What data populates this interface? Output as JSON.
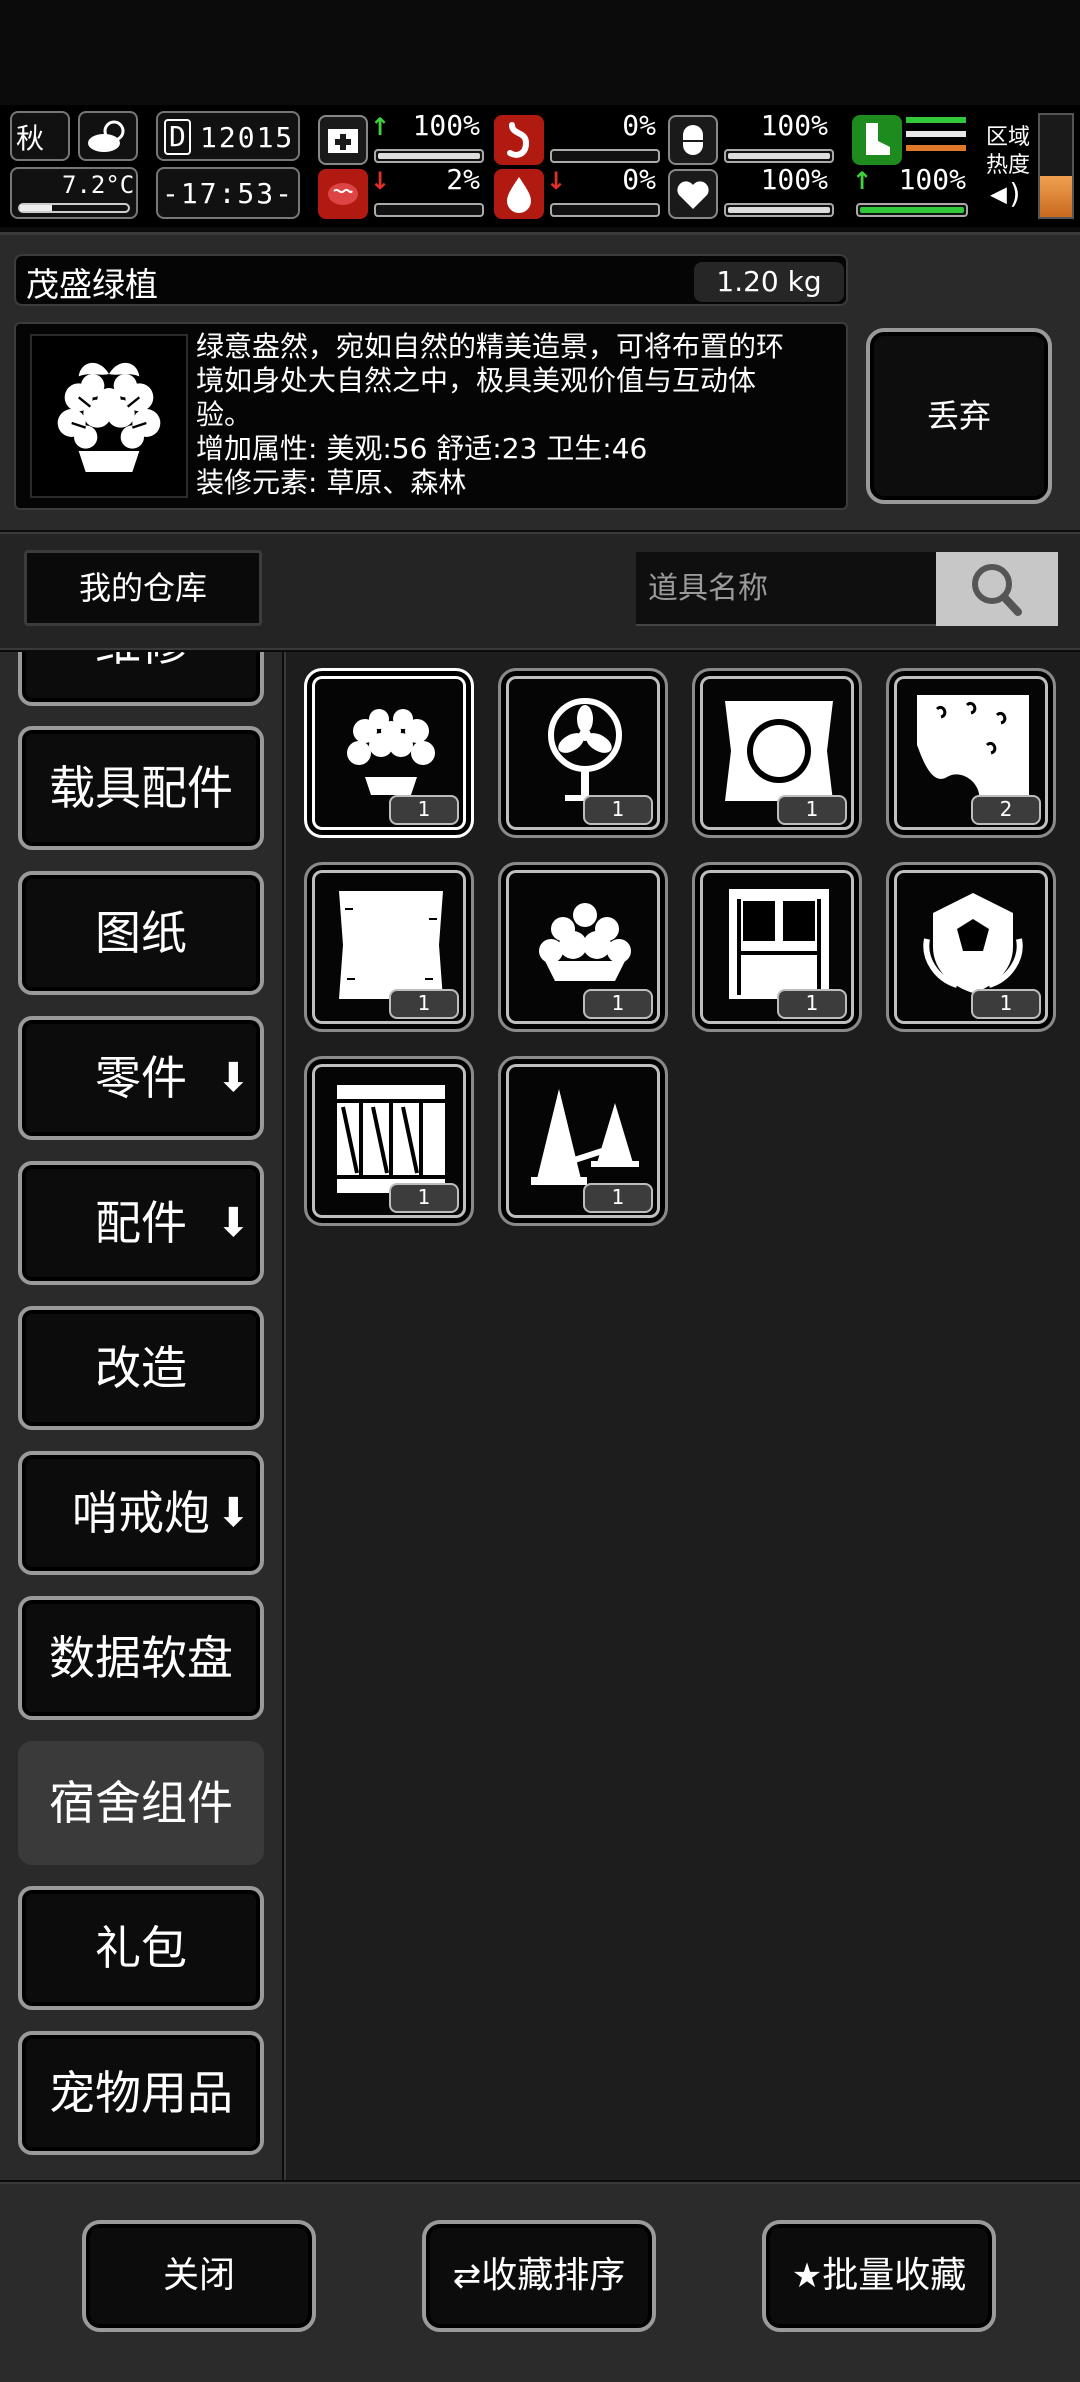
{
  "status": {
    "season": "秋",
    "day_counter": "12015",
    "day_prefix": "D",
    "temperature": "7.2°C",
    "clock": "-17:53-",
    "zone_label_1": "区域",
    "zone_label_2": "热度",
    "stats": [
      {
        "name": "health",
        "value": "100%",
        "trend": "up",
        "level": 1.0
      },
      {
        "name": "hunger",
        "value": "0%",
        "trend": "none",
        "level": 0.0
      },
      {
        "name": "thirst",
        "value": "100%",
        "trend": "none",
        "level": 1.0
      },
      {
        "name": "energy",
        "value": "100%",
        "trend": "none",
        "level": 1.0
      },
      {
        "name": "mental",
        "value": "2%",
        "trend": "down",
        "level": 0.02
      },
      {
        "name": "blood",
        "value": "0%",
        "trend": "down",
        "level": 0.0
      },
      {
        "name": "mood",
        "value": "100%",
        "trend": "none",
        "level": 1.0
      },
      {
        "name": "stamina",
        "value": "100%",
        "trend": "up",
        "level": 1.0
      }
    ],
    "accent_green": "#31c83a",
    "accent_red": "#e0302a"
  },
  "item": {
    "name": "茂盛绿植",
    "weight": "1.20 kg",
    "desc_line1": "绿意盎然，宛如自然的精美造景，可将布置的环",
    "desc_line2": "境如身处大自然之中，极具美观价值与互动体",
    "desc_line3": "验。",
    "attributes": "增加属性: 美观:56 舒适:23 卫生:46",
    "elements": "装修元素: 草原、森林",
    "icon": "potted-plant-icon",
    "discard_label": "丢弃"
  },
  "warehouse": {
    "label": "我的仓库",
    "search_placeholder": "道具名称"
  },
  "categories": [
    {
      "label": "维修",
      "arrow": false,
      "active": false
    },
    {
      "label": "载具配件",
      "arrow": false,
      "active": false
    },
    {
      "label": "图纸",
      "arrow": false,
      "active": false
    },
    {
      "label": "零件",
      "arrow": true,
      "active": false
    },
    {
      "label": "配件",
      "arrow": true,
      "active": false
    },
    {
      "label": "改造",
      "arrow": false,
      "active": false
    },
    {
      "label": "哨戒炮",
      "arrow": true,
      "active": false
    },
    {
      "label": "数据软盘",
      "arrow": false,
      "active": false
    },
    {
      "label": "宿舍组件",
      "arrow": false,
      "active": true
    },
    {
      "label": "礼包",
      "arrow": false,
      "active": false
    },
    {
      "label": "宠物用品",
      "arrow": false,
      "active": false
    }
  ],
  "inventory": [
    {
      "icon": "potted-plant-icon",
      "qty": "1",
      "selected": true
    },
    {
      "icon": "fan-icon",
      "qty": "1",
      "selected": false
    },
    {
      "icon": "pillow-icon",
      "qty": "1",
      "selected": false
    },
    {
      "icon": "wallpaper-icon",
      "qty": "2",
      "selected": false
    },
    {
      "icon": "rug-icon",
      "qty": "1",
      "selected": false
    },
    {
      "icon": "flower-pot-icon",
      "qty": "1",
      "selected": false
    },
    {
      "icon": "door-icon",
      "qty": "1",
      "selected": false
    },
    {
      "icon": "emblem-icon",
      "qty": "1",
      "selected": false
    },
    {
      "icon": "crate-icon",
      "qty": "1",
      "selected": false
    },
    {
      "icon": "traffic-cone-icon",
      "qty": "1",
      "selected": false
    }
  ],
  "buttons": {
    "close": "关闭",
    "sort_favorites": "收藏排序",
    "batch_favorite": "批量收藏"
  }
}
